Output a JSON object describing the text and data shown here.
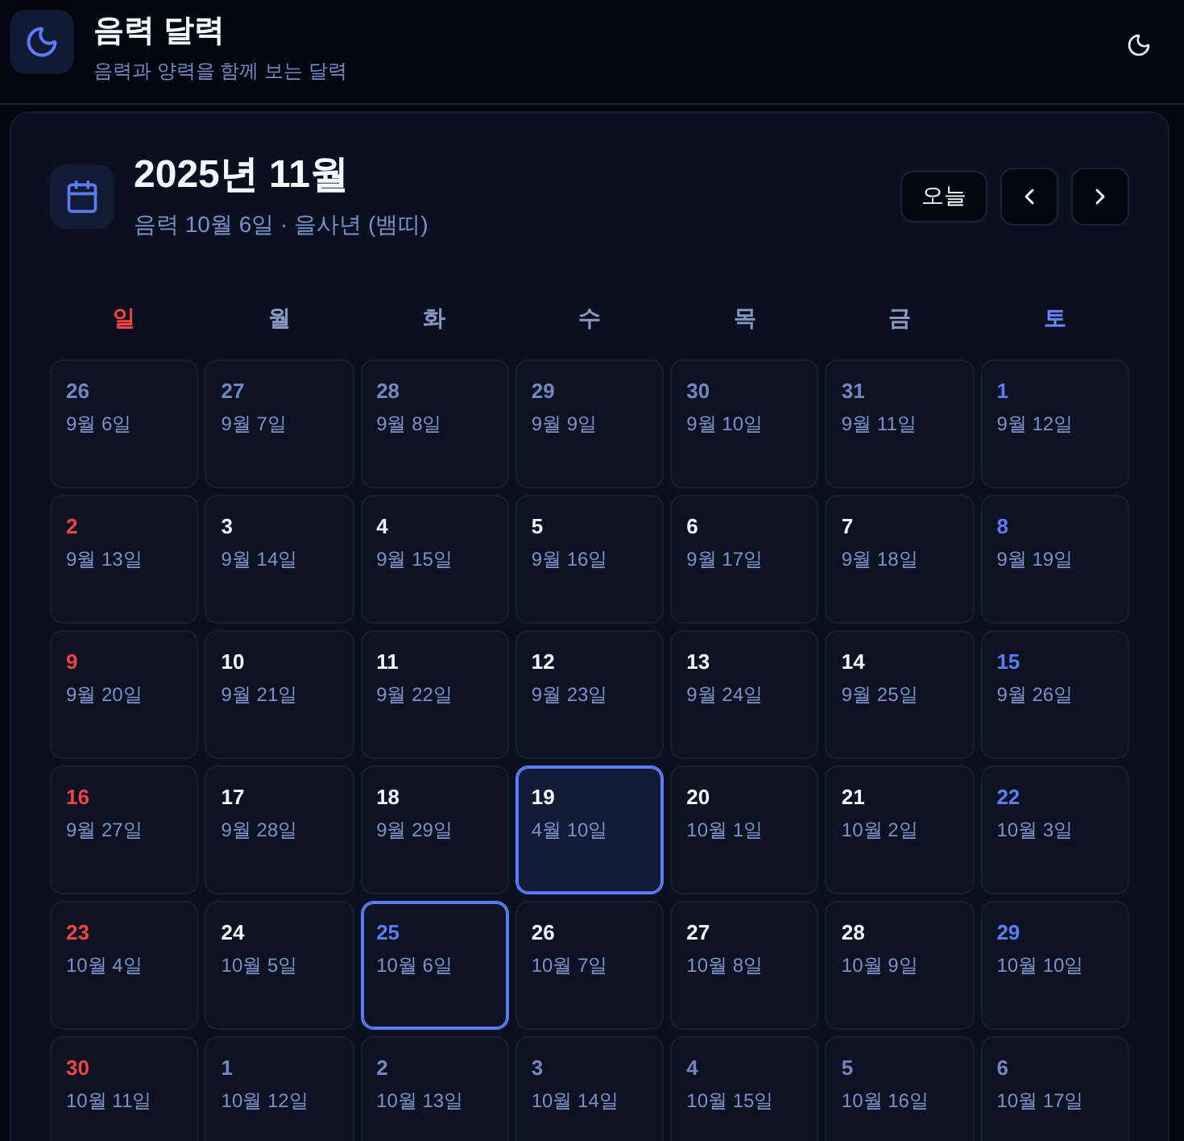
{
  "header": {
    "title": "음력 달력",
    "subtitle": "음력과 양력을 함께 보는 달력"
  },
  "calendar": {
    "title": "2025년 11월",
    "subtitle": "음력 10월 6일 · 을사년 (뱀띠)",
    "today_button": "오늘",
    "weekdays": [
      {
        "label": "일",
        "kind": "sunday"
      },
      {
        "label": "월",
        "kind": "weekday"
      },
      {
        "label": "화",
        "kind": "weekday"
      },
      {
        "label": "수",
        "kind": "weekday"
      },
      {
        "label": "목",
        "kind": "weekday"
      },
      {
        "label": "금",
        "kind": "weekday"
      },
      {
        "label": "토",
        "kind": "saturday"
      }
    ],
    "weeks": [
      {
        "days": [
          {
            "day": "26",
            "lunar": "9월 6일",
            "other_month": true,
            "selected": false,
            "today": false
          },
          {
            "day": "27",
            "lunar": "9월 7일",
            "other_month": true,
            "selected": false,
            "today": false
          },
          {
            "day": "28",
            "lunar": "9월 8일",
            "other_month": true,
            "selected": false,
            "today": false
          },
          {
            "day": "29",
            "lunar": "9월 9일",
            "other_month": true,
            "selected": false,
            "today": false
          },
          {
            "day": "30",
            "lunar": "9월 10일",
            "other_month": true,
            "selected": false,
            "today": false
          },
          {
            "day": "31",
            "lunar": "9월 11일",
            "other_month": true,
            "selected": false,
            "today": false
          },
          {
            "day": "1",
            "lunar": "9월 12일",
            "other_month": false,
            "selected": false,
            "today": false
          }
        ]
      },
      {
        "days": [
          {
            "day": "2",
            "lunar": "9월 13일",
            "other_month": false,
            "selected": false,
            "today": false
          },
          {
            "day": "3",
            "lunar": "9월 14일",
            "other_month": false,
            "selected": false,
            "today": false
          },
          {
            "day": "4",
            "lunar": "9월 15일",
            "other_month": false,
            "selected": false,
            "today": false
          },
          {
            "day": "5",
            "lunar": "9월 16일",
            "other_month": false,
            "selected": false,
            "today": false
          },
          {
            "day": "6",
            "lunar": "9월 17일",
            "other_month": false,
            "selected": false,
            "today": false
          },
          {
            "day": "7",
            "lunar": "9월 18일",
            "other_month": false,
            "selected": false,
            "today": false
          },
          {
            "day": "8",
            "lunar": "9월 19일",
            "other_month": false,
            "selected": false,
            "today": false
          }
        ]
      },
      {
        "days": [
          {
            "day": "9",
            "lunar": "9월 20일",
            "other_month": false,
            "selected": false,
            "today": false
          },
          {
            "day": "10",
            "lunar": "9월 21일",
            "other_month": false,
            "selected": false,
            "today": false
          },
          {
            "day": "11",
            "lunar": "9월 22일",
            "other_month": false,
            "selected": false,
            "today": false
          },
          {
            "day": "12",
            "lunar": "9월 23일",
            "other_month": false,
            "selected": false,
            "today": false
          },
          {
            "day": "13",
            "lunar": "9월 24일",
            "other_month": false,
            "selected": false,
            "today": false
          },
          {
            "day": "14",
            "lunar": "9월 25일",
            "other_month": false,
            "selected": false,
            "today": false
          },
          {
            "day": "15",
            "lunar": "9월 26일",
            "other_month": false,
            "selected": false,
            "today": false
          }
        ]
      },
      {
        "days": [
          {
            "day": "16",
            "lunar": "9월 27일",
            "other_month": false,
            "selected": false,
            "today": false
          },
          {
            "day": "17",
            "lunar": "9월 28일",
            "other_month": false,
            "selected": false,
            "today": false
          },
          {
            "day": "18",
            "lunar": "9월 29일",
            "other_month": false,
            "selected": false,
            "today": false
          },
          {
            "day": "19",
            "lunar": "4월 10일",
            "other_month": false,
            "selected": false,
            "today": true
          },
          {
            "day": "20",
            "lunar": "10월 1일",
            "other_month": false,
            "selected": false,
            "today": false
          },
          {
            "day": "21",
            "lunar": "10월 2일",
            "other_month": false,
            "selected": false,
            "today": false
          },
          {
            "day": "22",
            "lunar": "10월 3일",
            "other_month": false,
            "selected": false,
            "today": false
          }
        ]
      },
      {
        "days": [
          {
            "day": "23",
            "lunar": "10월 4일",
            "other_month": false,
            "selected": false,
            "today": false
          },
          {
            "day": "24",
            "lunar": "10월 5일",
            "other_month": false,
            "selected": false,
            "today": false
          },
          {
            "day": "25",
            "lunar": "10월 6일",
            "other_month": false,
            "selected": true,
            "today": false
          },
          {
            "day": "26",
            "lunar": "10월 7일",
            "other_month": false,
            "selected": false,
            "today": false
          },
          {
            "day": "27",
            "lunar": "10월 8일",
            "other_month": false,
            "selected": false,
            "today": false
          },
          {
            "day": "28",
            "lunar": "10월 9일",
            "other_month": false,
            "selected": false,
            "today": false
          },
          {
            "day": "29",
            "lunar": "10월 10일",
            "other_month": false,
            "selected": false,
            "today": false
          }
        ]
      },
      {
        "days": [
          {
            "day": "30",
            "lunar": "10월 11일",
            "other_month": false,
            "selected": false,
            "today": false
          },
          {
            "day": "1",
            "lunar": "10월 12일",
            "other_month": true,
            "selected": false,
            "today": false
          },
          {
            "day": "2",
            "lunar": "10월 13일",
            "other_month": true,
            "selected": false,
            "today": false
          },
          {
            "day": "3",
            "lunar": "10월 14일",
            "other_month": true,
            "selected": false,
            "today": false
          },
          {
            "day": "4",
            "lunar": "10월 15일",
            "other_month": true,
            "selected": false,
            "today": false
          },
          {
            "day": "5",
            "lunar": "10월 16일",
            "other_month": true,
            "selected": false,
            "today": false
          },
          {
            "day": "6",
            "lunar": "10월 17일",
            "other_month": true,
            "selected": false,
            "today": false
          }
        ]
      }
    ]
  }
}
